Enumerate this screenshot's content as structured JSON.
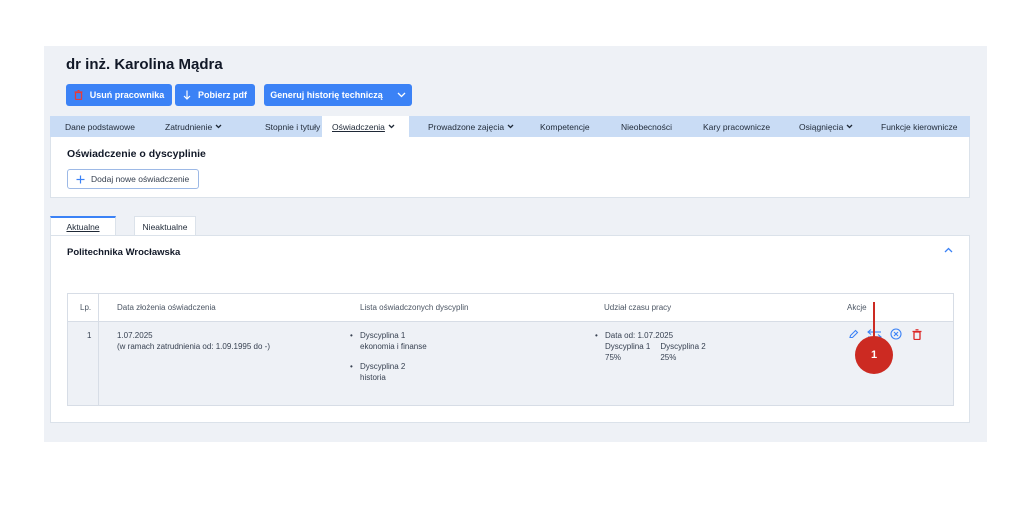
{
  "header": {
    "title": "dr inż. Karolina Mądra"
  },
  "toolbar": {
    "delete_employee": "Usuń pracownika",
    "download_pdf": "Pobierz pdf",
    "generate_history": "Generuj historię techniczą"
  },
  "tabs": [
    {
      "label": "Dane podstawowe",
      "dropdown": false
    },
    {
      "label": "Zatrudnienie",
      "dropdown": true
    },
    {
      "label": "Stopnie i tytuły",
      "dropdown": false
    },
    {
      "label": "Oświadczenia",
      "dropdown": true,
      "active": true
    },
    {
      "label": "Prowadzone zajęcia",
      "dropdown": true
    },
    {
      "label": "Kompetencje",
      "dropdown": false
    },
    {
      "label": "Nieobecności",
      "dropdown": false
    },
    {
      "label": "Kary pracownicze",
      "dropdown": false
    },
    {
      "label": "Osiągnięcia",
      "dropdown": true
    },
    {
      "label": "Funkcje kierownicze",
      "dropdown": false
    }
  ],
  "section": {
    "title": "Oświadczenie o dyscyplinie",
    "add_button": "Dodaj nowe oświadczenie"
  },
  "subtabs": {
    "current": "Aktualne",
    "outdated": "Nieaktualne"
  },
  "organization": "Politechnika Wrocławska",
  "table": {
    "headers": [
      "Lp.",
      "Data złożenia oświadczenia",
      "Lista oświadczonych dyscyplin",
      "Udział czasu pracy",
      "Akcje"
    ],
    "row": {
      "lp": "1",
      "date": "1.07.2025",
      "employment_note": "(w ramach zatrudnienia od: 1.09.1995 do -)",
      "disciplines": [
        {
          "name": "Dyscyplina 1",
          "field": "ekonomia i finanse"
        },
        {
          "name": "Dyscyplina 2",
          "field": "historia"
        }
      ],
      "time_share": {
        "date_label": "Data od: 1.07.2025",
        "d1_label": "Dyscyplina 1",
        "d1_value": "75%",
        "d2_label": "Dyscyplina 2",
        "d2_value": "25%"
      }
    }
  },
  "marker": {
    "label": "1"
  },
  "colors": {
    "primary": "#3b82f6",
    "tab_bar": "#c9dcf5",
    "background": "#eef1f6",
    "marker": "#cc2a22",
    "delete_icon": "#dc2626"
  }
}
